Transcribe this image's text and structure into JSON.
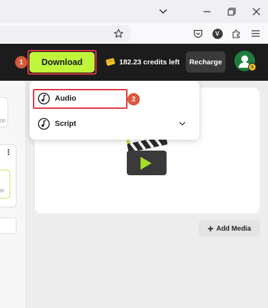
{
  "browser": {
    "icons": {
      "tab_list": "chevron-down-icon",
      "minimize": "minimize-icon",
      "restore": "restore-icon",
      "close": "close-icon",
      "bookmark": "star-icon",
      "pocket": "pocket-icon",
      "extension_v": "v-extension-icon",
      "extensions": "puzzle-icon",
      "menu": "hamburger-menu-icon"
    },
    "extension_v_letter": "V"
  },
  "header": {
    "download_label": "Download",
    "credits_text": "182.23 credits left",
    "recharge_label": "Recharge",
    "accent_color": "#bff53a"
  },
  "steps": {
    "step1": "1",
    "step2": "2"
  },
  "download_menu": {
    "items": [
      {
        "label": "Audio",
        "icon": "music-note-icon"
      },
      {
        "label": "Script",
        "icon": "music-note-icon",
        "has_submenu": true
      }
    ]
  },
  "main": {
    "add_media_label": "Add Media"
  },
  "left_panel": {
    "partial_text_1": "00",
    "partial_text_2": "00"
  }
}
